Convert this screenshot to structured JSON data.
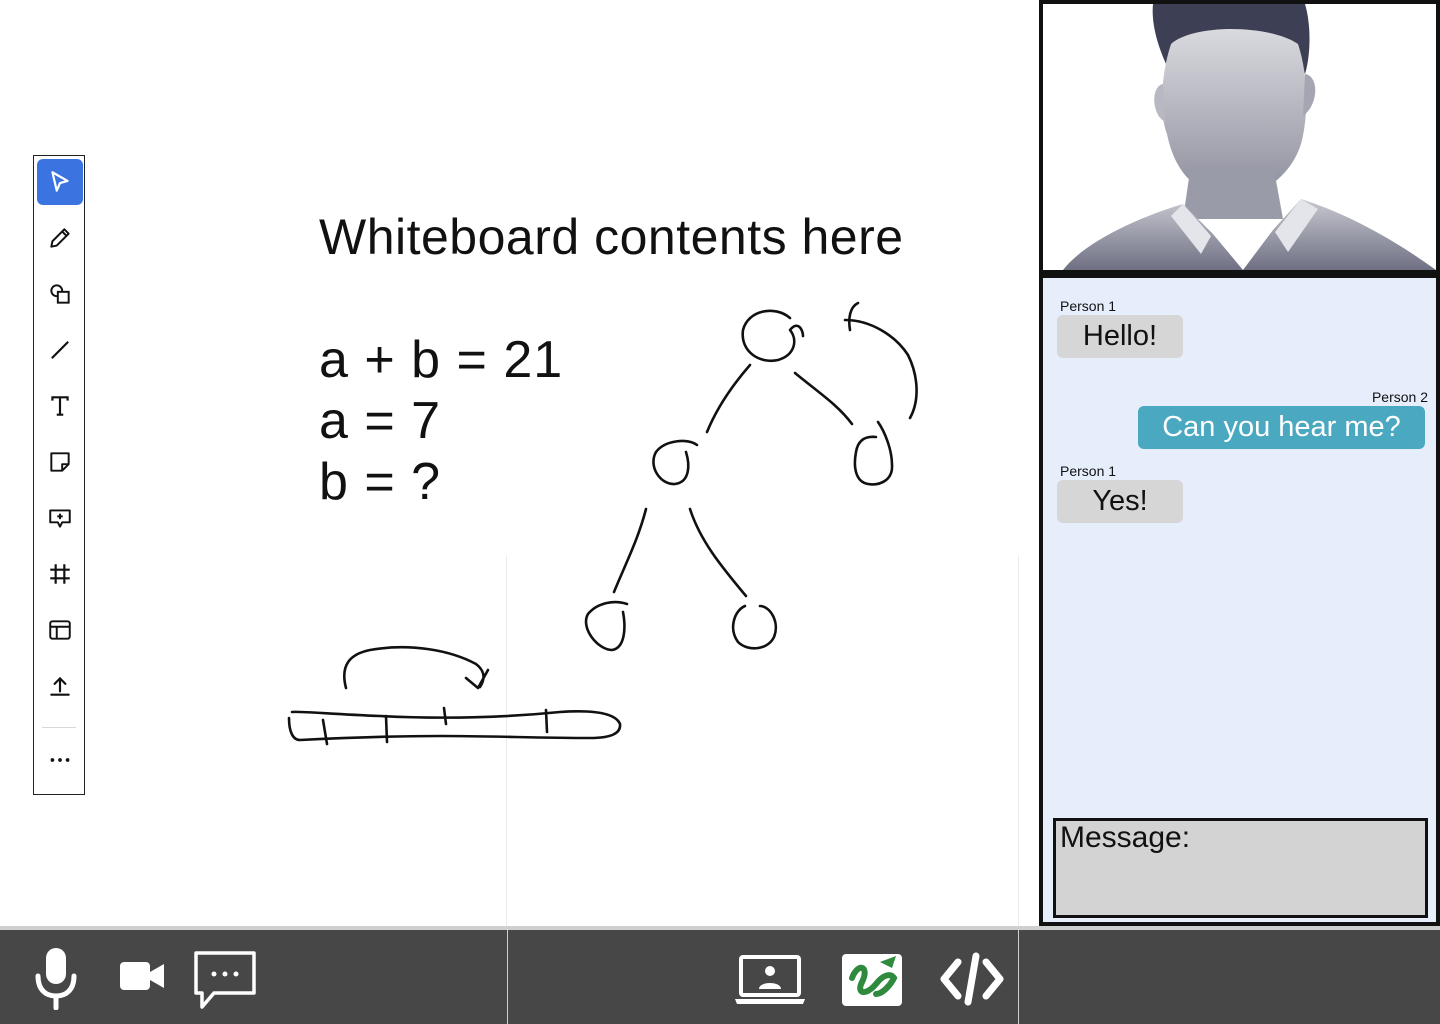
{
  "toolbar": {
    "tools": [
      {
        "name": "select",
        "icon": "cursor-arrow-icon",
        "active": true
      },
      {
        "name": "pen",
        "icon": "pencil-icon"
      },
      {
        "name": "shapes",
        "icon": "shapes-icon"
      },
      {
        "name": "line",
        "icon": "line-icon"
      },
      {
        "name": "text",
        "icon": "text-icon"
      },
      {
        "name": "sticky-note",
        "icon": "sticky-note-icon"
      },
      {
        "name": "comment",
        "icon": "comment-add-icon"
      },
      {
        "name": "frame",
        "icon": "frame-icon"
      },
      {
        "name": "template",
        "icon": "layout-template-icon"
      },
      {
        "name": "upload",
        "icon": "upload-icon"
      },
      {
        "name": "more",
        "icon": "more-dots-icon"
      }
    ],
    "active_color": "#3b74e0"
  },
  "whiteboard": {
    "title": "Whiteboard contents here",
    "equations": [
      "a + b = 21",
      "a = 7",
      "b = ?"
    ]
  },
  "chat": {
    "messages": [
      {
        "sender": "Person 1",
        "text": "Hello!",
        "direction": "incoming"
      },
      {
        "sender": "Person 2",
        "text": "Can you hear me?",
        "direction": "outgoing"
      },
      {
        "sender": "Person 1",
        "text": "Yes!",
        "direction": "incoming"
      }
    ],
    "input_placeholder": "Message:",
    "background": "#e6eefc",
    "outgoing_color": "#4aa8c0",
    "incoming_color": "#d6d6d6"
  },
  "bottom_bar": {
    "buttons": [
      {
        "name": "microphone",
        "icon": "microphone-icon"
      },
      {
        "name": "camera",
        "icon": "video-camera-icon"
      },
      {
        "name": "chat",
        "icon": "chat-bubble-icon"
      },
      {
        "name": "screen-share",
        "icon": "screen-share-icon"
      },
      {
        "name": "whiteboard",
        "icon": "whiteboard-app-icon"
      },
      {
        "name": "code",
        "icon": "code-icon"
      }
    ],
    "background": "#474747"
  },
  "video": {
    "participant_icon": "person-silhouette-icon"
  }
}
